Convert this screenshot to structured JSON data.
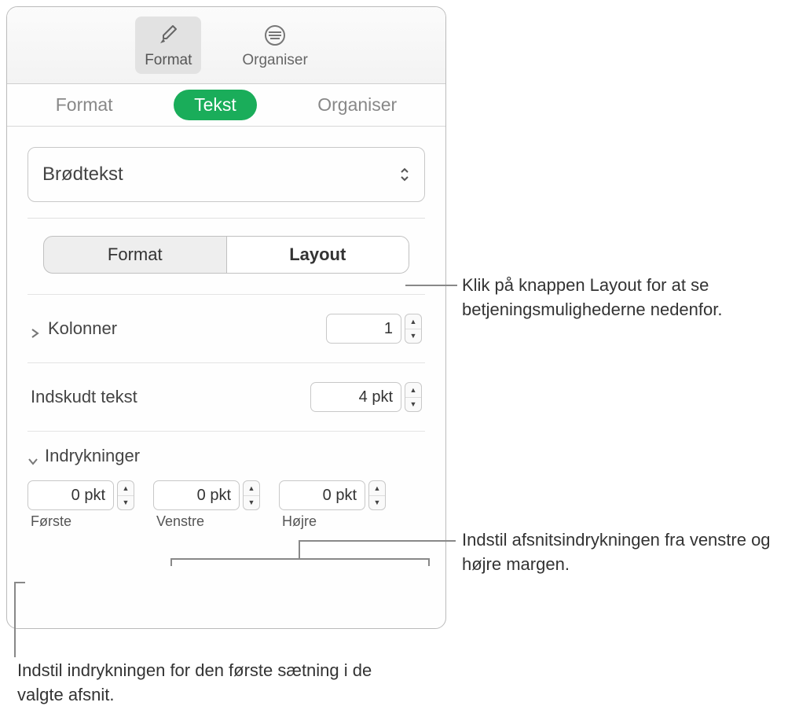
{
  "toolbar": {
    "format": "Format",
    "organize": "Organiser"
  },
  "tabs": {
    "format": "Format",
    "tekst": "Tekst",
    "organiser": "Organiser"
  },
  "style_dropdown": {
    "value": "Brødtekst"
  },
  "segmented": {
    "format": "Format",
    "layout": "Layout"
  },
  "columns": {
    "label": "Kolonner",
    "value": "1"
  },
  "inset": {
    "label": "Indskudt tekst",
    "value": "4 pkt"
  },
  "indents": {
    "label": "Indrykninger",
    "first": {
      "label": "Første",
      "value": "0 pkt"
    },
    "left": {
      "label": "Venstre",
      "value": "0 pkt"
    },
    "right": {
      "label": "Højre",
      "value": "0 pkt"
    }
  },
  "callouts": {
    "layout_btn": "Klik på knappen Layout for at se betjeningsmulighederne nedenfor.",
    "left_right": "Indstil afsnitsindrykningen fra venstre og højre margen.",
    "first": "Indstil indrykningen for den første sætning i de valgte afsnit."
  }
}
